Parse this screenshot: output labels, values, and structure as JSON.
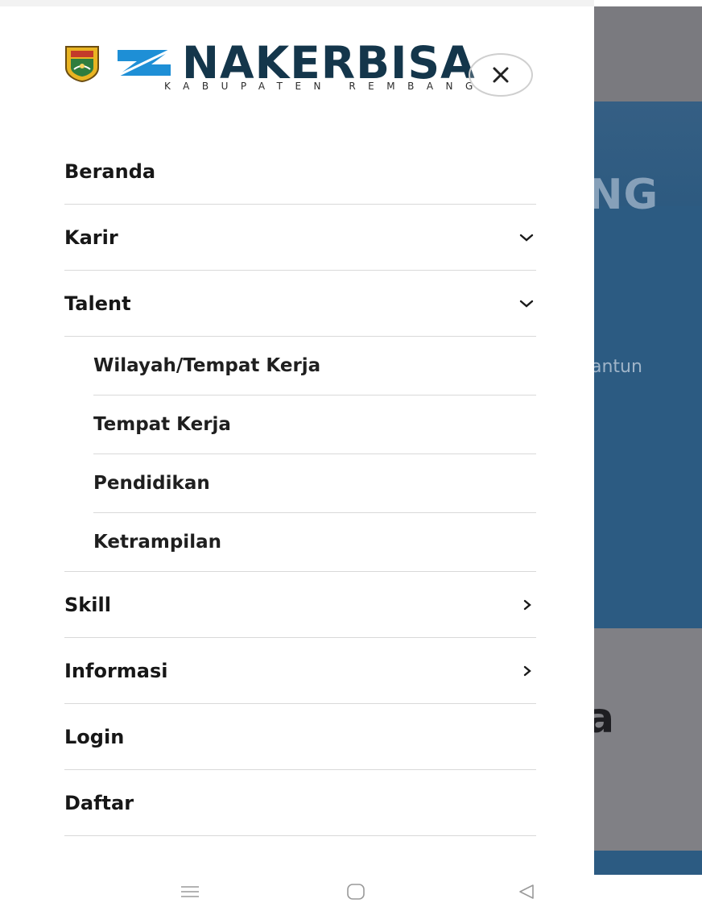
{
  "background": {
    "hero_text": "NG",
    "hero_subtext": "antun",
    "lower_text": "a"
  },
  "logo": {
    "brand": "NAKERBISA",
    "subtitle": "KABUPATEN REMBANG"
  },
  "menu": {
    "items": [
      {
        "label": "Beranda",
        "indicator": "none"
      },
      {
        "label": "Karir",
        "indicator": "chevron-down-icon"
      },
      {
        "label": "Talent",
        "indicator": "chevron-down-icon"
      }
    ],
    "talent_subitems": [
      {
        "label": "Wilayah/Tempat Kerja"
      },
      {
        "label": "Tempat Kerja"
      },
      {
        "label": "Pendidikan"
      },
      {
        "label": "Ketrampilan"
      }
    ],
    "items_after": [
      {
        "label": "Skill",
        "indicator": "chevron-right-icon"
      },
      {
        "label": "Informasi",
        "indicator": "chevron-right-icon"
      },
      {
        "label": "Login",
        "indicator": "none"
      },
      {
        "label": "Daftar",
        "indicator": "none"
      }
    ]
  },
  "colors": {
    "brand_navy": "#14364b",
    "swoosh_blue": "#1e8fd6",
    "hero_blue": "#2c5b82",
    "overlay_gray": "#7a7a7f"
  }
}
